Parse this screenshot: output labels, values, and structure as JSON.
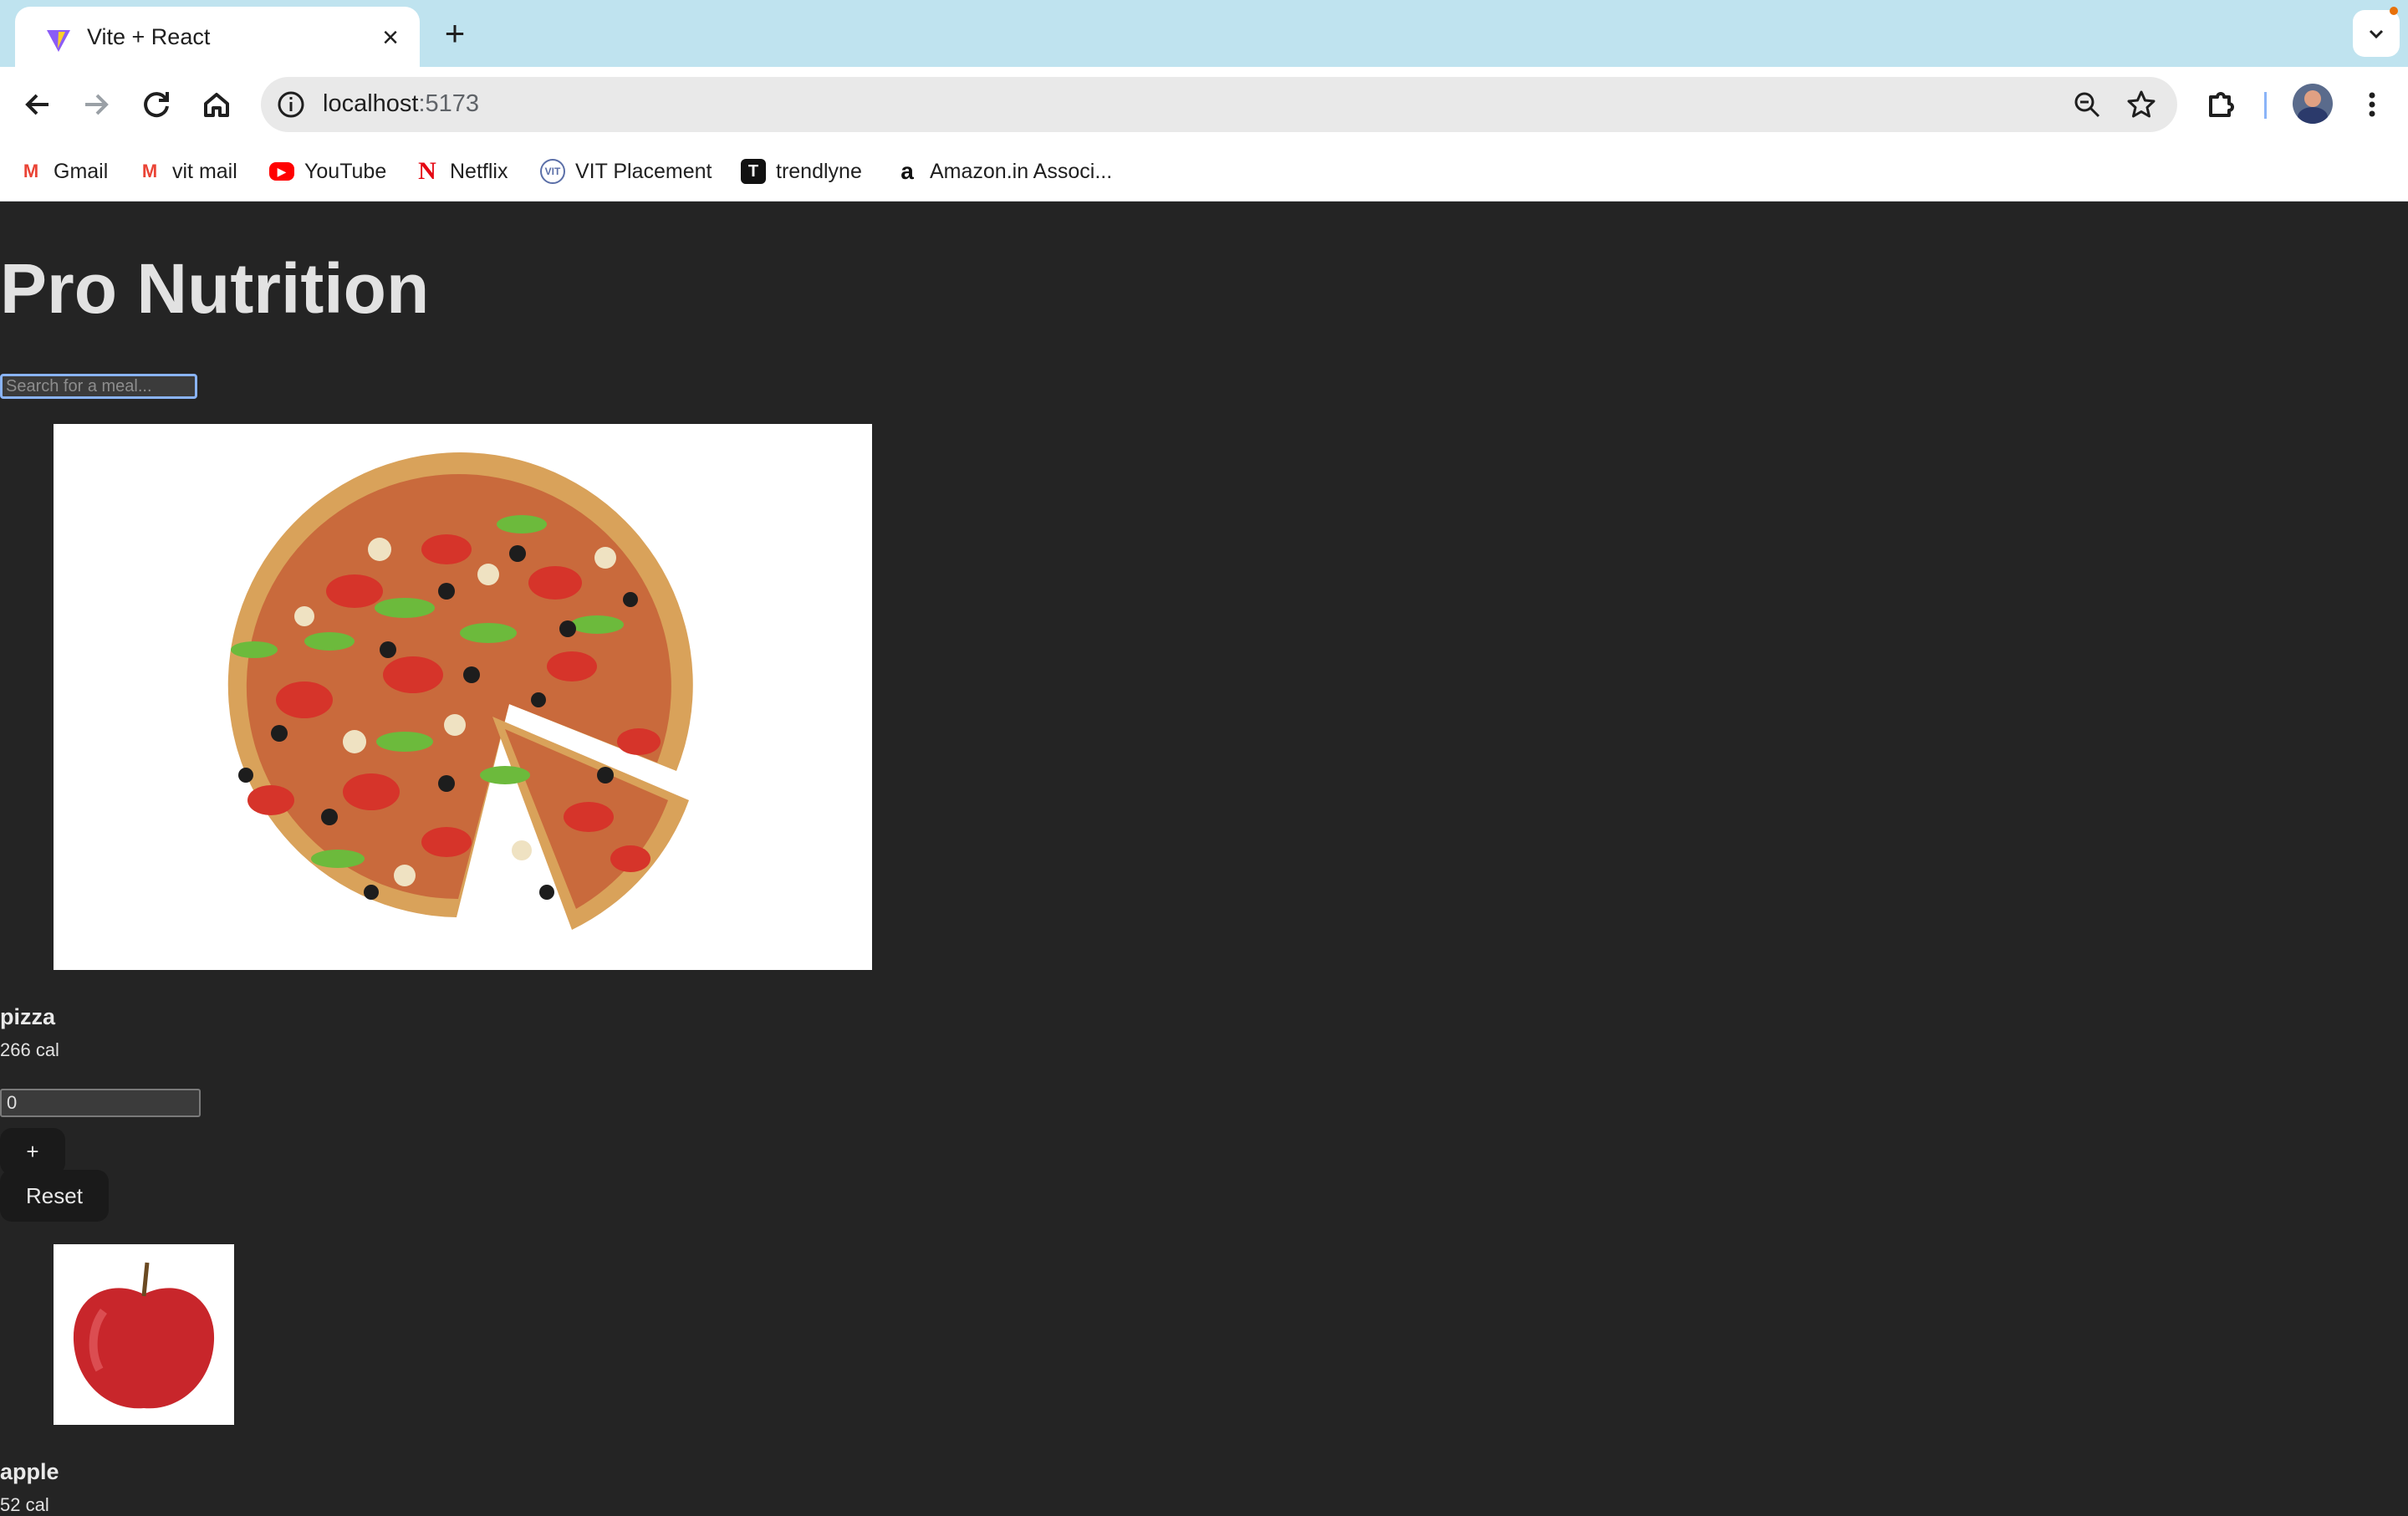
{
  "browser": {
    "tab": {
      "title": "Vite + React"
    },
    "address": {
      "host": "localhost",
      "port": ":5173"
    },
    "bookmarks": [
      {
        "label": "Gmail",
        "icon": "gmail-icon"
      },
      {
        "label": "vit mail",
        "icon": "gmail-icon"
      },
      {
        "label": "YouTube",
        "icon": "youtube-icon"
      },
      {
        "label": "Netflix",
        "icon": "netflix-icon"
      },
      {
        "label": "VIT Placement",
        "icon": "vit-icon"
      },
      {
        "label": "trendlyne",
        "icon": "trendlyne-icon"
      },
      {
        "label": "Amazon.in Associ...",
        "icon": "amazon-icon"
      }
    ],
    "colors": {
      "tabstrip": "#bfe3ef",
      "page_bg": "#242424"
    }
  },
  "app": {
    "title": "Pro Nutrition",
    "search": {
      "placeholder": "Search for a meal...",
      "value": ""
    },
    "foods": [
      {
        "name": "pizza",
        "calories": "266 cal",
        "quantity": "0",
        "image": "pizza-image"
      },
      {
        "name": "apple",
        "calories": "52 cal",
        "image": "apple-image"
      }
    ],
    "buttons": {
      "add": "+",
      "reset": "Reset"
    }
  }
}
